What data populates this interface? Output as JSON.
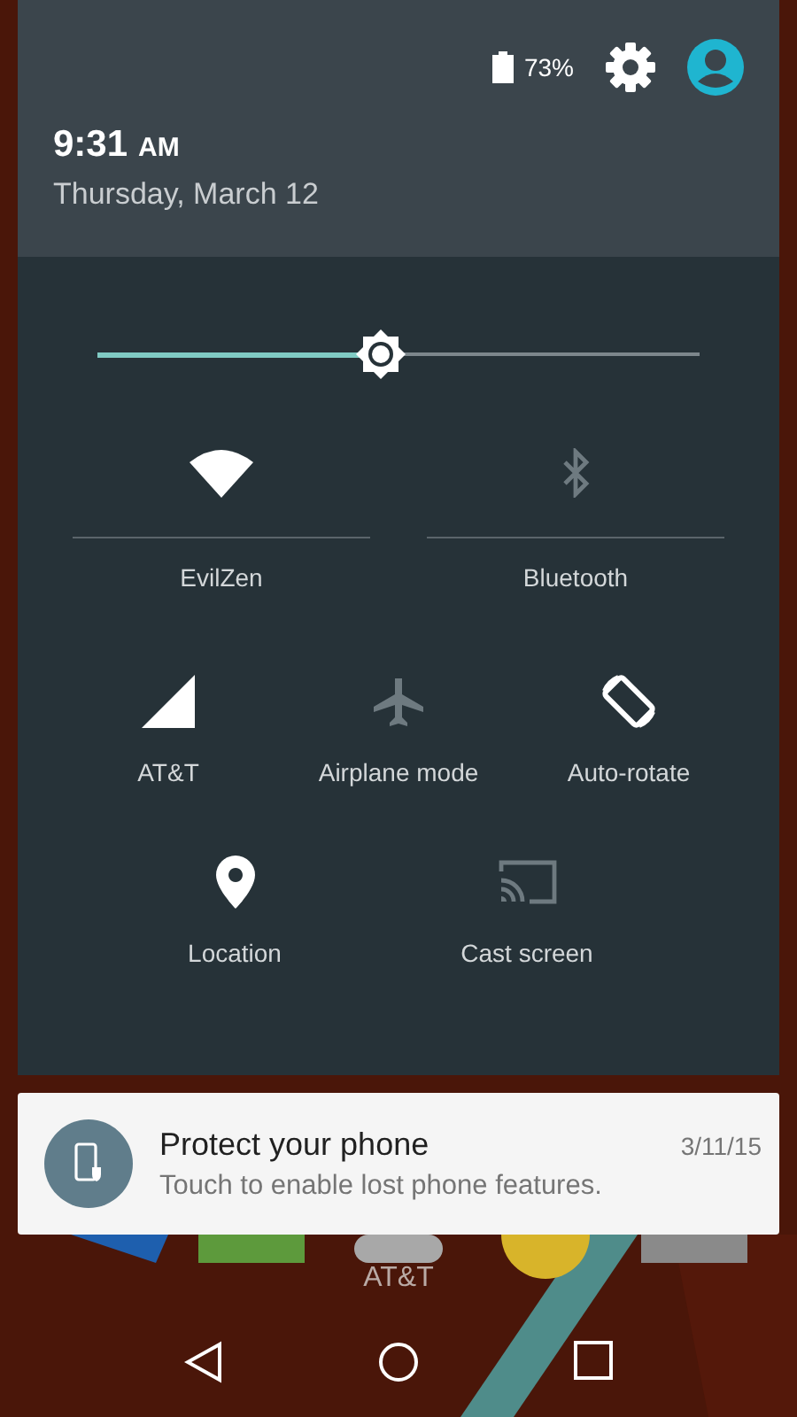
{
  "header": {
    "battery": "73%",
    "time": "9:31",
    "meridiem": "AM",
    "date": "Thursday, March 12"
  },
  "brightness": {
    "level": 0.47
  },
  "tiles": [
    {
      "kind": "large",
      "label": "EvilZen",
      "on": true
    },
    {
      "kind": "large",
      "label": "Bluetooth",
      "on": false
    },
    {
      "kind": "small",
      "label": "AT&T",
      "on": true
    },
    {
      "kind": "small",
      "label": "Airplane mode",
      "on": false
    },
    {
      "kind": "small",
      "label": "Auto-rotate",
      "on": true
    },
    {
      "kind": "small",
      "label": "Location",
      "on": true
    },
    {
      "kind": "small",
      "label": "Cast screen",
      "on": false
    }
  ],
  "notification": {
    "title": "Protect your phone",
    "text": "Touch to enable lost phone features.",
    "date": "3/11/15"
  },
  "home": {
    "carrier": "AT&T"
  }
}
